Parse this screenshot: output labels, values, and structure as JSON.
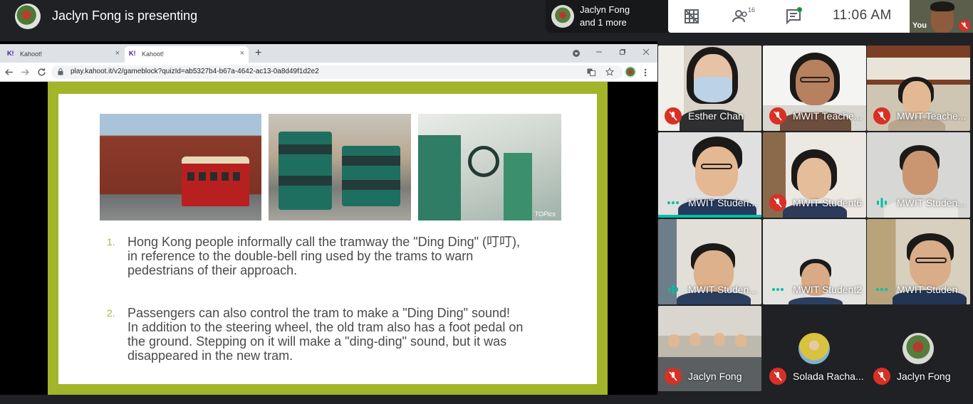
{
  "meeting": {
    "presenting_text": "Jaclyn Fong is presenting",
    "pinned_name_line1": "Jaclyn Fong",
    "pinned_name_line2": "and 1 more",
    "participant_count": "16",
    "clock": "11:06  AM",
    "self_label": "You"
  },
  "browser": {
    "tabs": [
      {
        "favicon": "K!",
        "title": "Kahoot!",
        "close": "×"
      },
      {
        "favicon": "K!",
        "title": "Kahoot!",
        "close": "×"
      }
    ],
    "new_tab": "+",
    "url": "play.kahoot.it/v2/gameblock?quizId=ab5327b4-b67a-4642-ac13-0a8d49f1d2e2"
  },
  "slide": {
    "photo_tag": "TOPics",
    "items": [
      {
        "num": "1.",
        "text": "Hong Kong people informally call the tramway the \"Ding Ding\" (叮叮),\nin reference to the double-bell ring used by the trams to warn\npedestrians of their approach."
      },
      {
        "num": "2.",
        "text": "Passengers can also control the tram to make a \"Ding Ding\" sound!\nIn addition to the steering wheel, the old tram also has a foot pedal on\nthe ground. Stepping on it will make a \"ding-ding\" sound, but it was\ndisappeared in the new tram."
      }
    ]
  },
  "participants": [
    {
      "name": "Esther Chan",
      "status": "muted"
    },
    {
      "name": "MWIT Teache...",
      "status": "muted"
    },
    {
      "name": "MWIT Teache...",
      "status": "muted"
    },
    {
      "name": "MWIT Studen...",
      "status": "speaking"
    },
    {
      "name": "MWIT Student6",
      "status": "muted"
    },
    {
      "name": "MWIT Studen...",
      "status": "speaking"
    },
    {
      "name": "MWIT Studen...",
      "status": "speaking"
    },
    {
      "name": "MWIT Student2",
      "status": "speaking"
    },
    {
      "name": "MWIT Studen...",
      "status": "speaking"
    },
    {
      "name": "Jaclyn Fong",
      "status": "muted"
    },
    {
      "name": "Solada Racha...",
      "status": "muted"
    },
    {
      "name": "Jaclyn Fong",
      "status": "muted"
    }
  ],
  "colors": {
    "muted_icon": "#d93025",
    "speaking_indicator": "#00bfa5",
    "slide_border": "#a2b42a"
  }
}
